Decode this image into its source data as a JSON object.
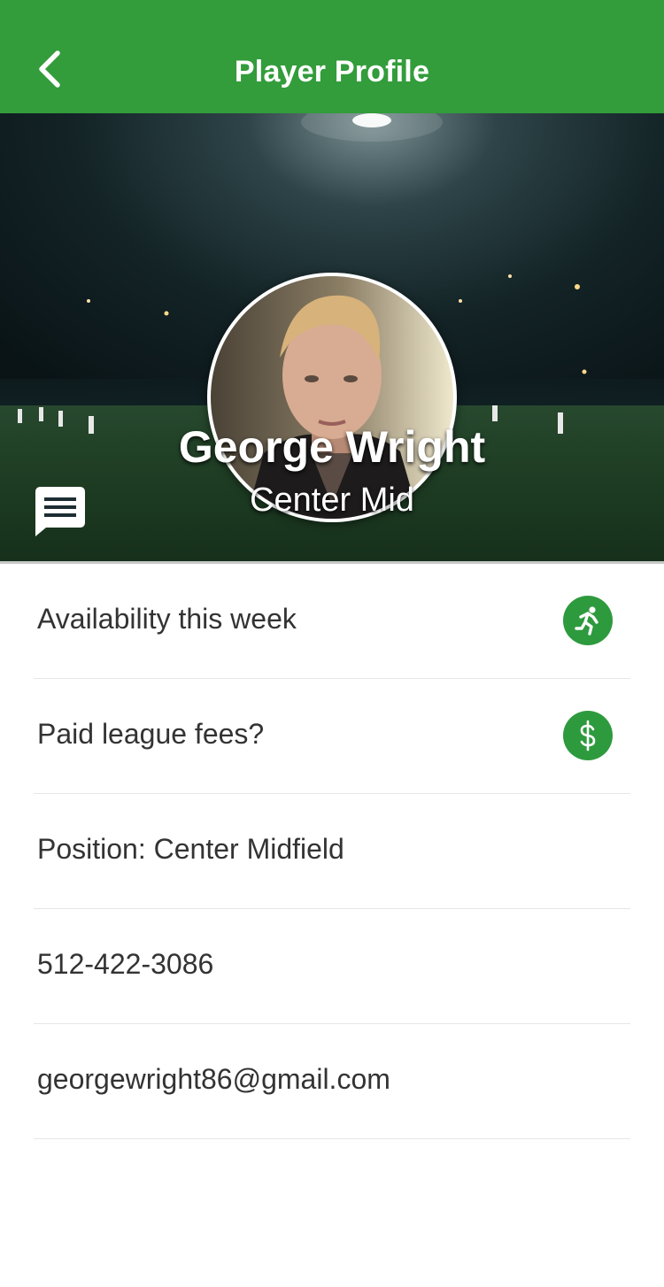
{
  "header": {
    "title": "Player Profile",
    "back_icon": "chevron-left-icon",
    "background_color": "#339c3b"
  },
  "profile": {
    "name": "George Wright",
    "position_short": "Center Mid",
    "message_icon": "chat-message-icon"
  },
  "info": {
    "availability": {
      "label": "Availability this week",
      "icon": "running-person-icon",
      "icon_color": "#2e9a3e"
    },
    "fees": {
      "label": "Paid league fees?",
      "icon": "dollar-icon",
      "icon_color": "#2e9a3e"
    },
    "position": {
      "label": "Position: Center Midfield"
    },
    "phone": {
      "label": "512-422-3086"
    },
    "email": {
      "label": "georgewright86@gmail.com"
    }
  }
}
